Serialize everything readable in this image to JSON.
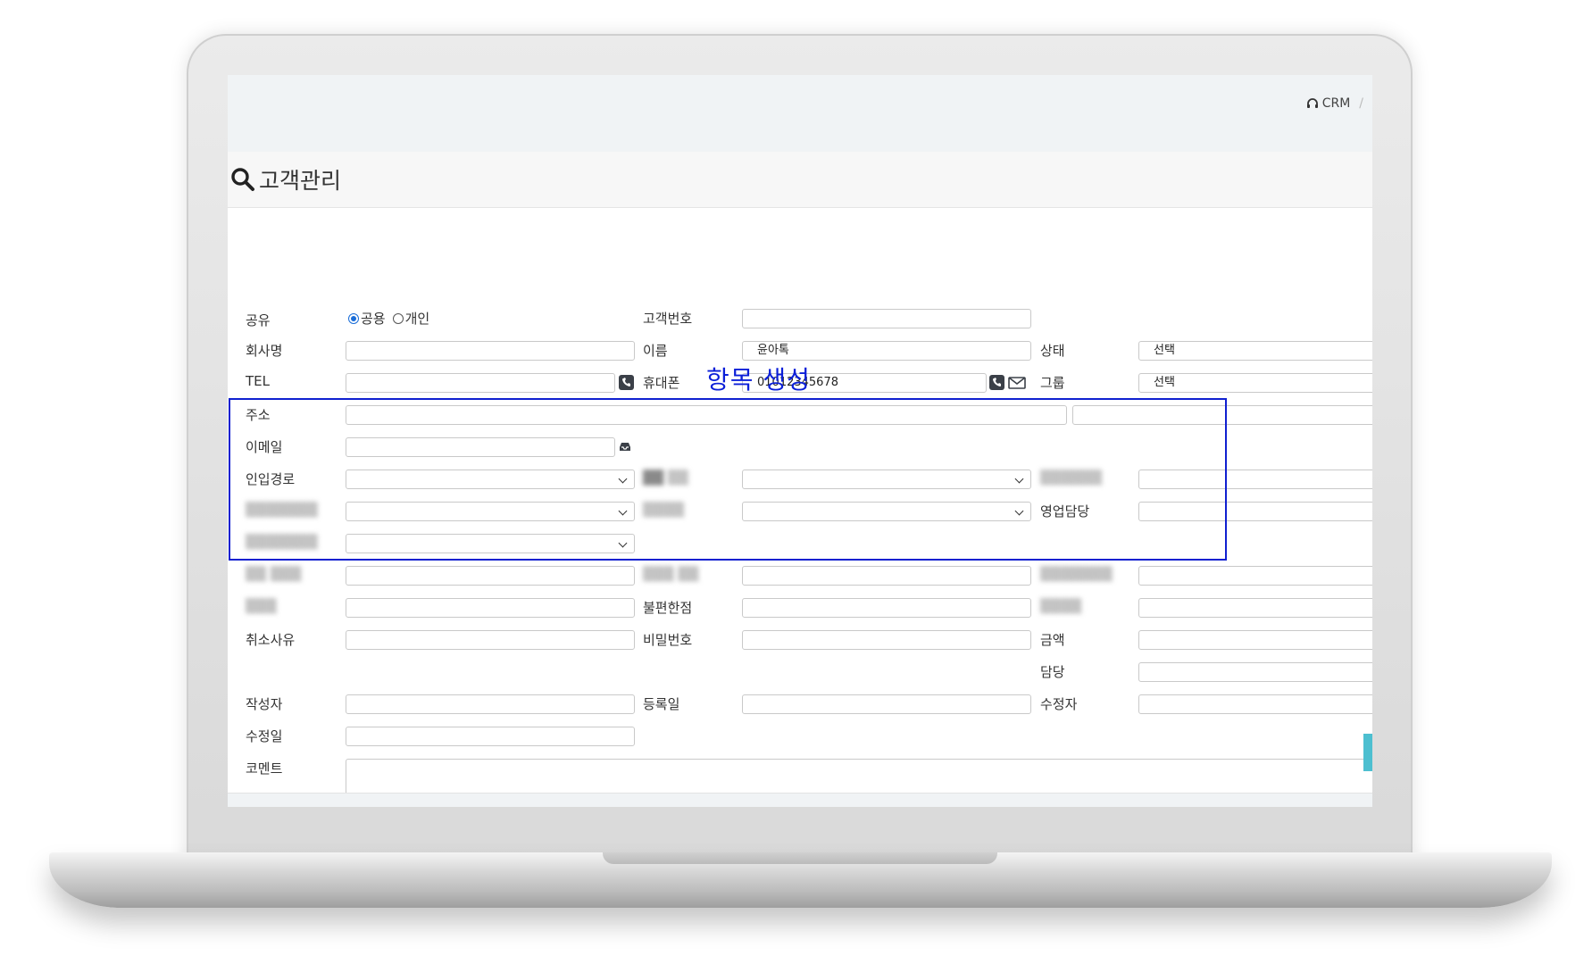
{
  "breadcrumb": {
    "root": "CRM",
    "separator": "/"
  },
  "page": {
    "title": "고객관리",
    "annotation": "항목 생성"
  },
  "form": {
    "share": {
      "label": "공유",
      "options": [
        "공용",
        "개인"
      ],
      "selected": "공용"
    },
    "customer_no": {
      "label": "고객번호",
      "value": ""
    },
    "company": {
      "label": "회사명",
      "value": ""
    },
    "name": {
      "label": "이름",
      "value": "윤아톡"
    },
    "status": {
      "label": "상태",
      "value": "선택"
    },
    "tel": {
      "label": "TEL",
      "value": ""
    },
    "mobile": {
      "label": "휴대폰",
      "value": "01012345678"
    },
    "group": {
      "label": "그룹",
      "value": "선택"
    },
    "address": {
      "label": "주소",
      "value": "",
      "value2": ""
    },
    "email": {
      "label": "이메일",
      "value": ""
    },
    "inflow": {
      "label": "인입경로",
      "value": ""
    },
    "sales_manager": {
      "label": "영업담당",
      "value": ""
    },
    "complaint": {
      "label": "불편한점",
      "value": ""
    },
    "password": {
      "label": "비밀번호",
      "value": ""
    },
    "cancel_reason": {
      "label": "취소사유",
      "value": ""
    },
    "amount": {
      "label": "금액",
      "value": ""
    },
    "assignee": {
      "label": "담당",
      "value": ""
    },
    "author": {
      "label": "작성자",
      "value": ""
    },
    "reg_date": {
      "label": "등록일",
      "value": ""
    },
    "editor": {
      "label": "수정자",
      "value": ""
    },
    "mod_date": {
      "label": "수정일",
      "value": ""
    },
    "comment": {
      "label": "코멘트",
      "value": ""
    }
  },
  "colors": {
    "accent": "#1a6dd8",
    "highlight": "#1020d0",
    "teal": "#4dbfd0"
  },
  "icons": [
    "headset-icon",
    "search-icon",
    "phone-icon",
    "mail-icon",
    "inbox-icon",
    "chevron-down-icon"
  ]
}
